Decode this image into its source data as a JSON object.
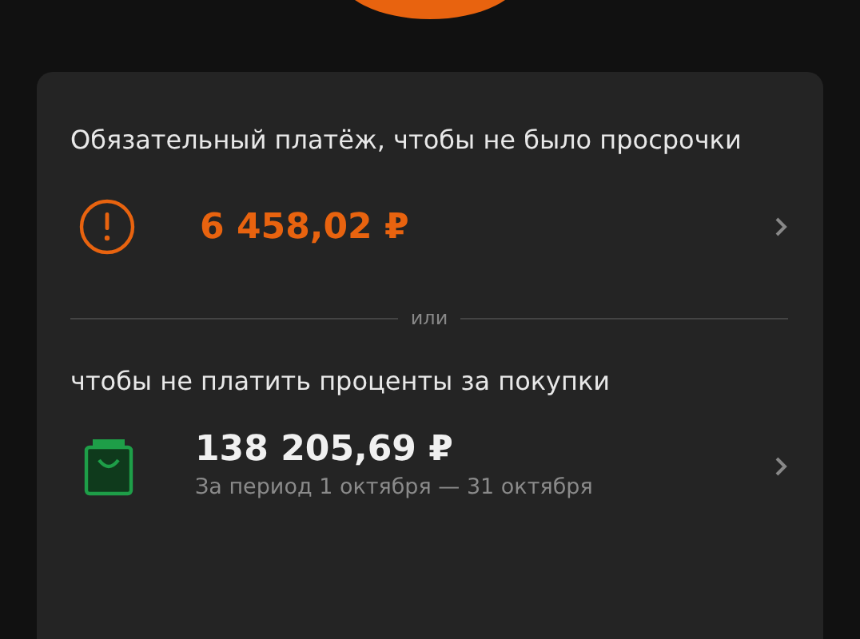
{
  "minimum_payment": {
    "title": "Обязательный платёж, чтобы не было просрочки",
    "amount": "6 458,02 ₽"
  },
  "divider_label": "или",
  "full_payment": {
    "title": "чтобы не платить проценты за покупки",
    "amount": "138 205,69 ₽",
    "period": "За период 1 октября — 31 октября"
  }
}
